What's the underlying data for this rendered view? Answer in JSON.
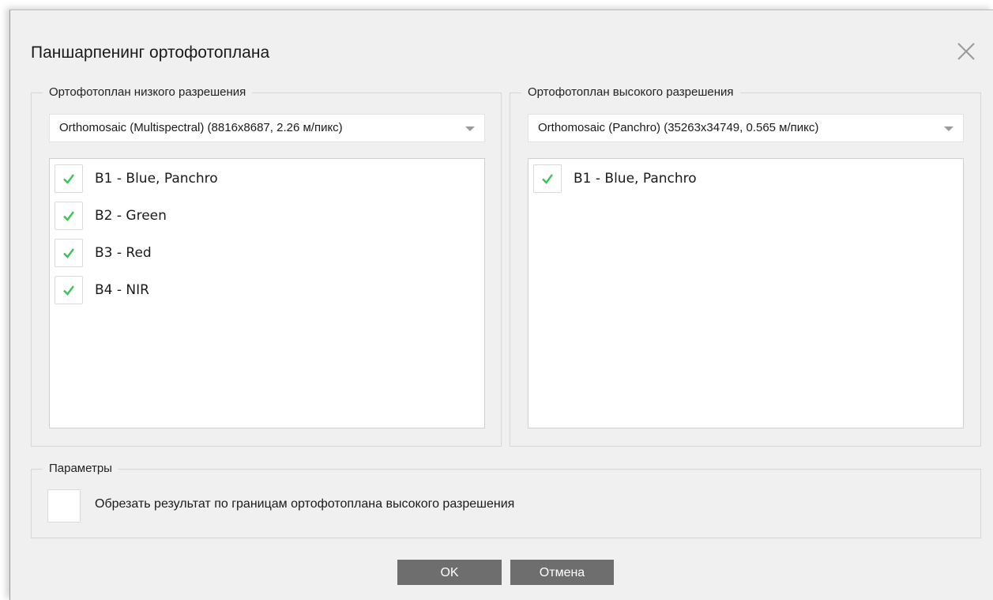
{
  "dialog": {
    "title": "Паншарпенинг ортофотоплана"
  },
  "low_res": {
    "legend": "Ортофотоплан низкого разрешения",
    "selected": "Orthomosaic (Multispectral) (8816x8687, 2.26 м/пикс)",
    "bands": [
      {
        "label": "B1 - Blue, Panchro",
        "checked": true
      },
      {
        "label": "B2 - Green",
        "checked": true
      },
      {
        "label": "B3 - Red",
        "checked": true
      },
      {
        "label": "B4 - NIR",
        "checked": true
      }
    ]
  },
  "high_res": {
    "legend": "Ортофотоплан высокого разрешения",
    "selected": "Orthomosaic (Panchro) (35263x34749, 0.565 м/пикс)",
    "bands": [
      {
        "label": "B1 - Blue, Panchro",
        "checked": true
      }
    ]
  },
  "params": {
    "legend": "Параметры",
    "clip_label": "Обрезать результат по границам ортофотоплана высокого разрешения",
    "clip_checked": false
  },
  "buttons": {
    "ok": "OK",
    "cancel": "Отмена"
  },
  "colors": {
    "check": "#3fc15a",
    "button_bg": "#6e6e6e",
    "dialog_bg": "#f0f0f0"
  },
  "icons": {
    "close": "close-icon",
    "dropdown": "chevron-down-icon",
    "check": "check-icon"
  }
}
